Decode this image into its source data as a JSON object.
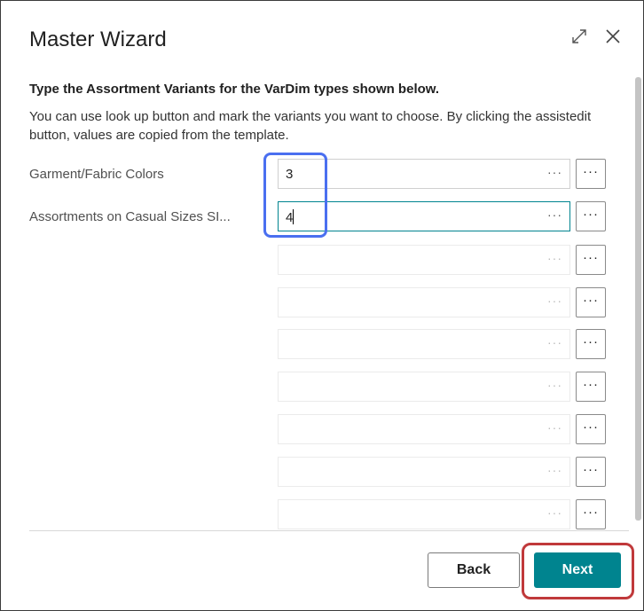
{
  "dialog": {
    "title": "Master Wizard",
    "icons": [
      "expand-icon",
      "close-icon"
    ]
  },
  "content": {
    "heading": "Type the Assortment Variants for the VarDim types shown below.",
    "description": "You can use look up button and mark the variants you want to choose. By clicking the assistedit button, values are copied from the template."
  },
  "rows": [
    {
      "label": "Garment/Fabric Colors",
      "value": "3",
      "lookup": "···",
      "assist": "···"
    },
    {
      "label": "Assortments on Casual Sizes SI...",
      "value": "4",
      "lookup": "···",
      "assist": "···"
    },
    {
      "label": "",
      "value": "",
      "lookup": "···",
      "assist": "···"
    },
    {
      "label": "",
      "value": "",
      "lookup": "···",
      "assist": "···"
    },
    {
      "label": "",
      "value": "",
      "lookup": "···",
      "assist": "···"
    },
    {
      "label": "",
      "value": "",
      "lookup": "···",
      "assist": "···"
    },
    {
      "label": "",
      "value": "",
      "lookup": "···",
      "assist": "···"
    },
    {
      "label": "",
      "value": "",
      "lookup": "···",
      "assist": "···"
    },
    {
      "label": "",
      "value": "",
      "lookup": "···",
      "assist": "···"
    }
  ],
  "footer": {
    "back_label": "Back",
    "next_label": "Next"
  },
  "colors": {
    "accent": "#00848f",
    "highlight_blue": "#4a6ff0",
    "highlight_red": "#c0393b"
  }
}
